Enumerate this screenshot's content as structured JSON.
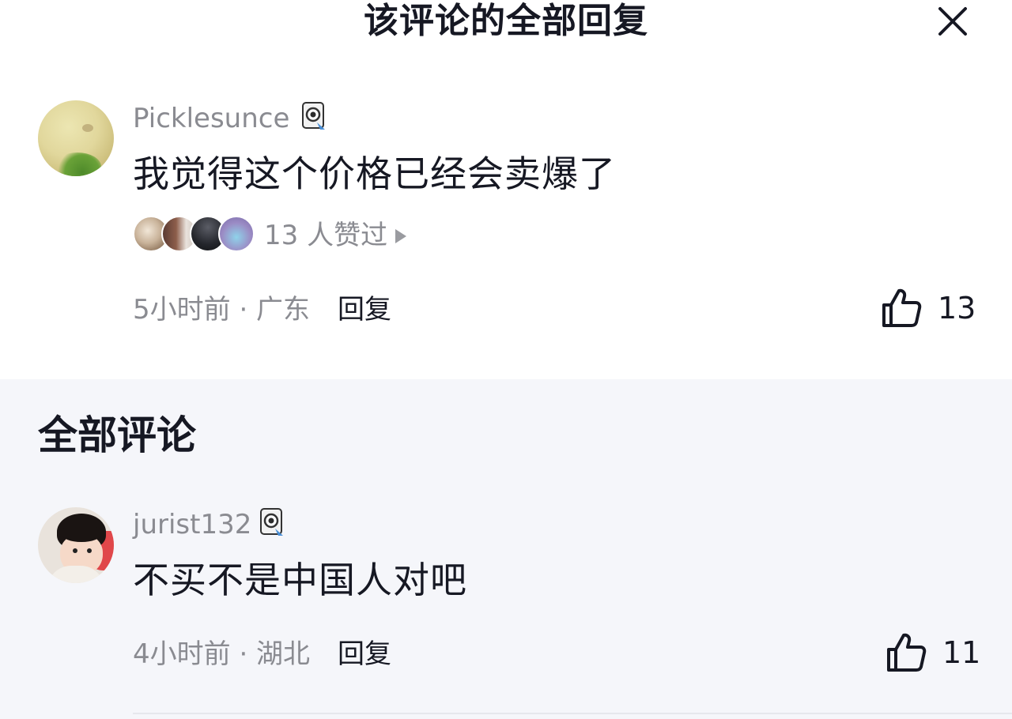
{
  "header": {
    "title": "该评论的全部回复"
  },
  "top_comment": {
    "username": "Picklesunce",
    "text": "我觉得这个价格已经会卖爆了",
    "likers_count_text": "13 人赞过",
    "time_location": "5小时前 · 广东",
    "reply_label": "回复",
    "like_count": "13"
  },
  "all_comments": {
    "title": "全部评论",
    "items": [
      {
        "username": "jurist132",
        "text": "不买不是中国人对吧",
        "time_location": "4小时前 · 湖北",
        "reply_label": "回复",
        "like_count": "11"
      }
    ]
  },
  "colors": {
    "primary_text": "#161823",
    "secondary_text": "#8a8b91",
    "section_bg": "#f5f6fa"
  }
}
